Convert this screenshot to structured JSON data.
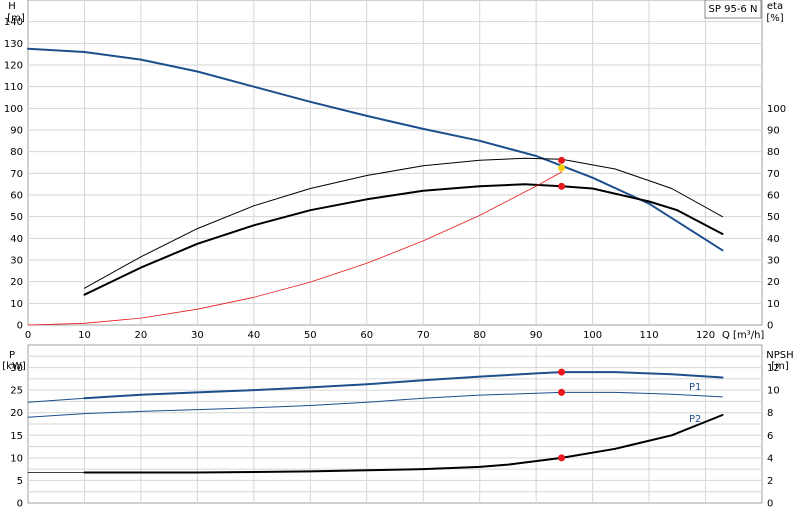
{
  "chart_data": [
    {
      "type": "line",
      "legend_text": "SP 95-6 N",
      "left_axis": {
        "label_line1": "H",
        "label_line2": "[m]",
        "range": [
          0,
          150
        ],
        "ticks": [
          0,
          10,
          20,
          30,
          40,
          50,
          60,
          70,
          80,
          90,
          100,
          110,
          120,
          130,
          140
        ]
      },
      "right_axis": {
        "label_line1": "eta",
        "label_line2": "[%]",
        "range": [
          0,
          150
        ],
        "ticks": [
          0,
          10,
          20,
          30,
          40,
          50,
          60,
          70,
          80,
          90,
          100
        ]
      },
      "x_axis": {
        "label": "Q [m³/h]",
        "range": [
          0,
          130
        ],
        "ticks": [
          0,
          10,
          20,
          30,
          40,
          50,
          60,
          70,
          80,
          90,
          100,
          110,
          120
        ]
      },
      "grid": true,
      "series": [
        {
          "key": "H",
          "color": "#1c4f8c",
          "width": 2,
          "x": [
            0,
            10,
            20,
            30,
            40,
            50,
            60,
            70,
            80,
            90,
            95,
            100,
            110,
            123
          ],
          "y": [
            127.5,
            126,
            122.5,
            117,
            110,
            103,
            96.5,
            90.5,
            85,
            78,
            73,
            68,
            56,
            34.5
          ]
        },
        {
          "key": "eta_total",
          "color": "#000000",
          "width": 2,
          "x": [
            10,
            20,
            30,
            40,
            50,
            60,
            70,
            80,
            88,
            94.5,
            100,
            110,
            115,
            123
          ],
          "y": [
            14,
            26.5,
            37.5,
            46,
            53,
            58,
            62,
            64,
            65,
            64,
            63,
            57,
            53,
            42
          ]
        },
        {
          "key": "eta_pump",
          "color": "#000000",
          "width": 1,
          "x": [
            10,
            20,
            30,
            40,
            50,
            60,
            70,
            80,
            88,
            94.5,
            104,
            114,
            123
          ],
          "y": [
            17,
            31.5,
            44.5,
            55,
            63,
            69,
            73.5,
            76,
            77,
            76.5,
            72,
            63,
            50
          ]
        },
        {
          "key": "system_curve",
          "color": "#e8181c",
          "width": 0.8,
          "x": [
            0,
            10,
            20,
            30,
            40,
            50,
            60,
            70,
            80,
            90,
            94.5
          ],
          "y": [
            0,
            0.8,
            3.2,
            7.3,
            12.8,
            19.8,
            28.5,
            38.8,
            50.6,
            64.1,
            70.6
          ]
        }
      ],
      "points": [
        {
          "x": 94.5,
          "y": 76,
          "color": "#e8181c"
        },
        {
          "x": 94.5,
          "y": 72.5,
          "color": "#f5d000"
        },
        {
          "x": 94.5,
          "y": 64,
          "color": "#e8181c"
        }
      ]
    },
    {
      "type": "line",
      "left_axis": {
        "label_line1": "P",
        "label_line2": "[kW]",
        "range": [
          0,
          35
        ],
        "ticks": [
          0,
          5,
          10,
          15,
          20,
          25,
          30
        ]
      },
      "right_axis": {
        "label_line1": "NPSH",
        "label_line2": "[m]",
        "range": [
          0,
          14
        ],
        "ticks": [
          0,
          2,
          4,
          6,
          8,
          10,
          12
        ]
      },
      "x_axis": {
        "range": [
          0,
          130
        ],
        "ticks": [
          0,
          10,
          20,
          30,
          40,
          50,
          60,
          70,
          80,
          90,
          100,
          110,
          120
        ]
      },
      "grid": true,
      "series": [
        {
          "key": "P1",
          "label": "P1",
          "axis": "left",
          "color": "#1c4f8c",
          "width": 2,
          "x": [
            10,
            20,
            30,
            40,
            50,
            60,
            70,
            80,
            90,
            94.5,
            104,
            114,
            123
          ],
          "y": [
            23.2,
            24,
            24.5,
            25,
            25.6,
            26.3,
            27.2,
            28,
            28.7,
            29,
            29,
            28.5,
            27.8
          ]
        },
        {
          "key": "P1_low",
          "axis": "left",
          "color": "#1c4f8c",
          "width": 1,
          "x": [
            0,
            10
          ],
          "y": [
            22.3,
            23.2
          ]
        },
        {
          "key": "P2",
          "label": "P2",
          "axis": "left",
          "color": "#1c4f8c",
          "width": 1,
          "x": [
            0,
            10,
            20,
            30,
            40,
            50,
            60,
            70,
            80,
            90,
            94.5,
            104,
            114,
            123
          ],
          "y": [
            19,
            19.8,
            20.3,
            20.7,
            21.1,
            21.6,
            22.3,
            23.2,
            23.9,
            24.3,
            24.5,
            24.5,
            24.1,
            23.5
          ]
        },
        {
          "key": "NPSH_low",
          "axis": "right",
          "color": "#000000",
          "width": 0.8,
          "x": [
            0,
            10
          ],
          "y": [
            2.7,
            2.7
          ]
        },
        {
          "key": "NPSH",
          "axis": "right",
          "color": "#000000",
          "width": 2,
          "x": [
            10,
            20,
            30,
            40,
            50,
            60,
            70,
            80,
            85,
            94.5,
            104,
            114,
            123
          ],
          "y": [
            2.7,
            2.7,
            2.7,
            2.75,
            2.8,
            2.9,
            3.0,
            3.2,
            3.4,
            4.0,
            4.8,
            6.0,
            7.8
          ]
        }
      ],
      "points": [
        {
          "x": 94.5,
          "y": 29,
          "axis": "left",
          "color": "#e8181c"
        },
        {
          "x": 94.5,
          "y": 24.5,
          "axis": "left",
          "color": "#e8181c"
        },
        {
          "x": 94.5,
          "y": 4.0,
          "axis": "right",
          "color": "#e8181c"
        }
      ]
    }
  ]
}
